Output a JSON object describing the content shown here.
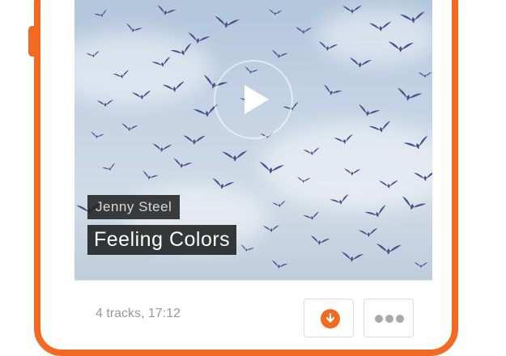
{
  "playlist": {
    "artist": "Jenny Steel",
    "title": "Feeling Colors",
    "meta": "4 tracks, 17:12"
  },
  "icons": {
    "play": "play-icon",
    "download": "download-icon",
    "more": "more-dots-icon",
    "birds": "bird-icon"
  },
  "colors": {
    "accent": "#f26a21",
    "sky": "#c4d3e4",
    "bird": "#4a4e8c",
    "label_bg": "#222222",
    "meta_text": "#999999"
  }
}
